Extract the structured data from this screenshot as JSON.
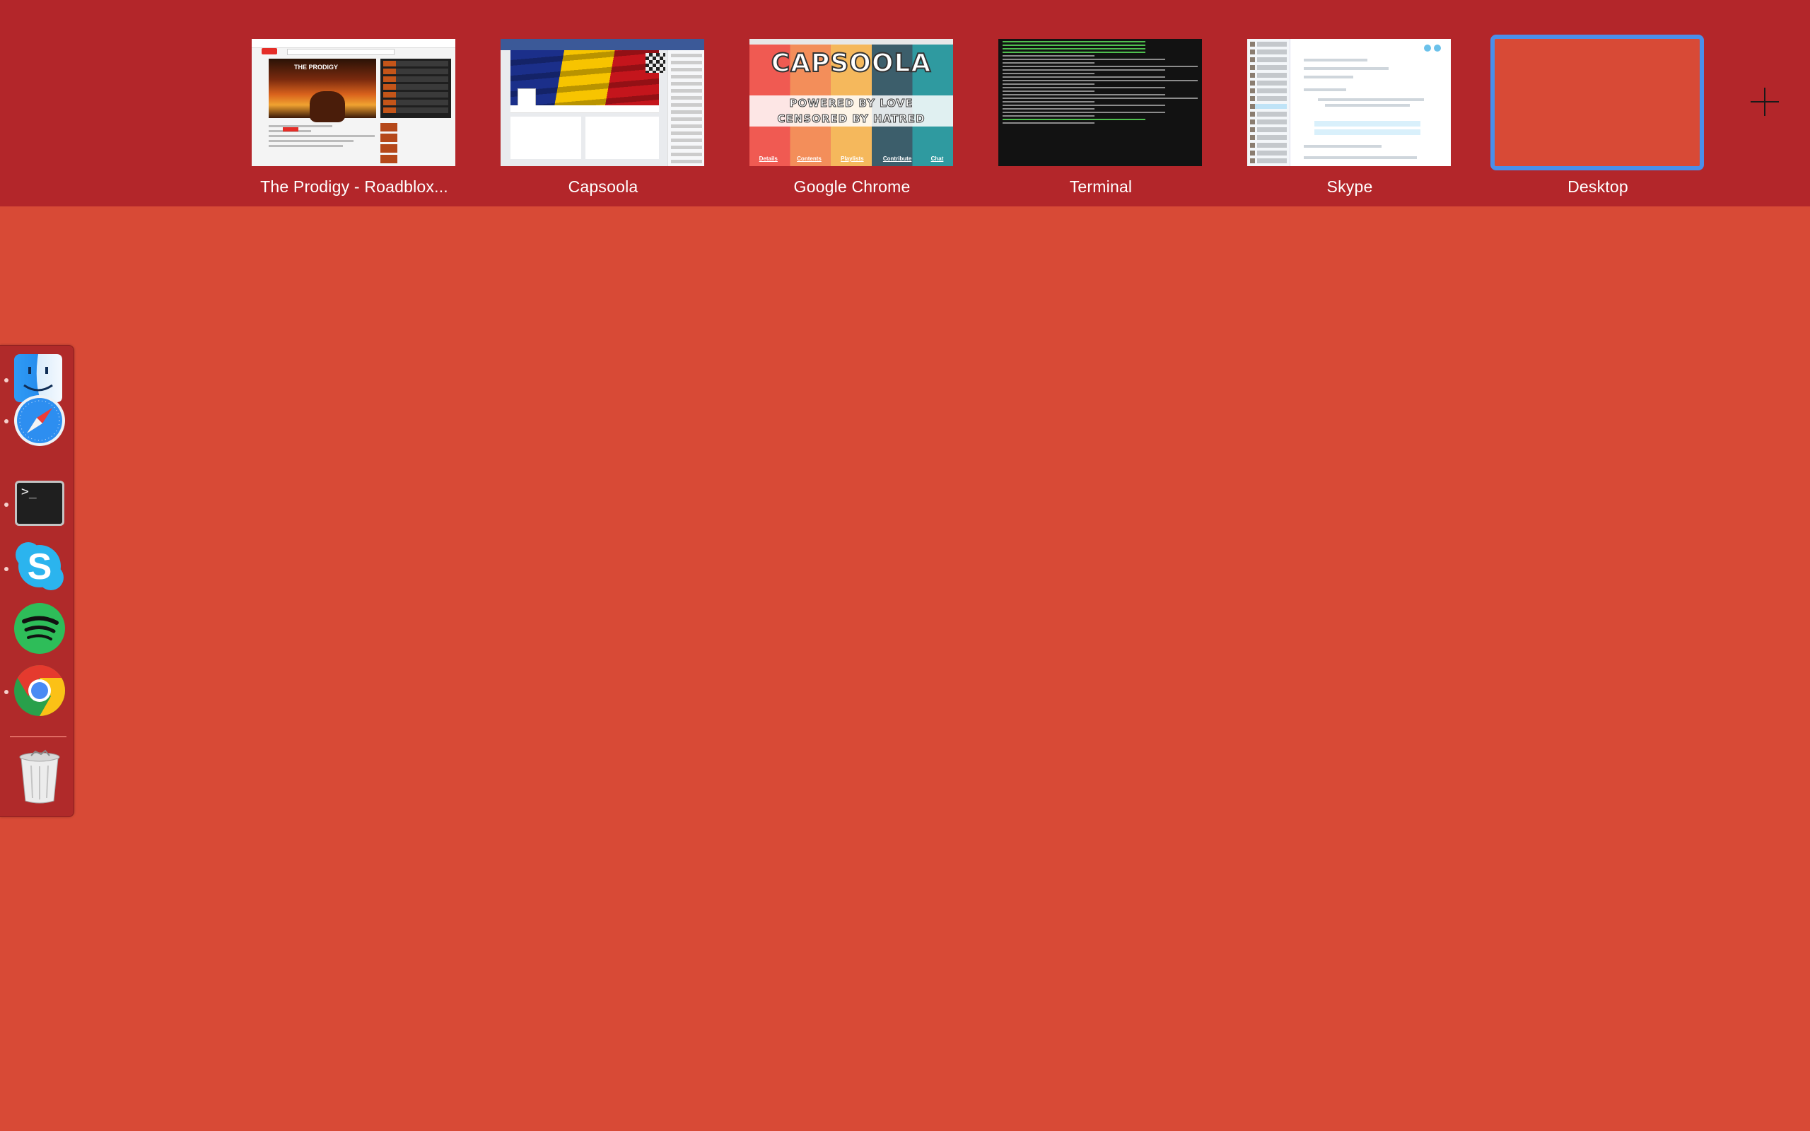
{
  "spaces": [
    {
      "label": "The Prodigy - Roadblox...",
      "thumb_title": "THE PRODIGY"
    },
    {
      "label": "Capsoola"
    },
    {
      "label": "Google Chrome",
      "thumb_title": "CAPSOOLA",
      "thumb_line1": "POWERED BY LOVE",
      "thumb_line2": "CENSORED BY HATRED",
      "thumb_links": [
        "Details",
        "Contents",
        "Playlists",
        "Contribute",
        "Chat"
      ]
    },
    {
      "label": "Terminal"
    },
    {
      "label": "Skype"
    },
    {
      "label": "Desktop",
      "selected": true
    }
  ],
  "add_space_icon": "plus-icon",
  "dock": {
    "items": [
      {
        "name": "finder",
        "icon": "finder-icon",
        "running": true
      },
      {
        "name": "safari",
        "icon": "safari-icon",
        "running": true
      },
      {
        "name": "terminal",
        "icon": "terminal-icon",
        "running": true
      },
      {
        "name": "skype",
        "icon": "skype-icon",
        "running": true
      },
      {
        "name": "spotify",
        "icon": "spotify-icon",
        "running": false
      },
      {
        "name": "chrome",
        "icon": "chrome-icon",
        "running": true
      },
      {
        "name": "trash",
        "icon": "trash-icon",
        "running": false
      }
    ],
    "terminal_glyph": ">_"
  },
  "colors": {
    "desktop": "#d84a36",
    "spaces_bar": "#b3262a",
    "selection": "#4a8fea"
  }
}
